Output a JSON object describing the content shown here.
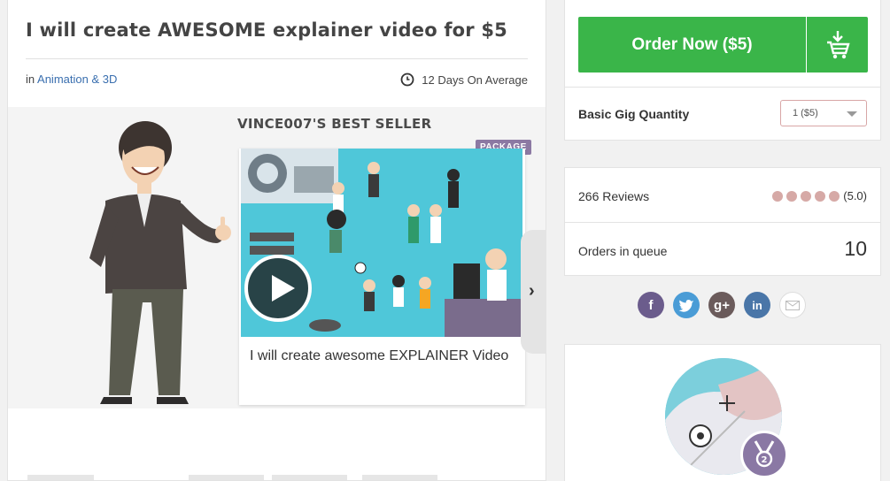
{
  "gig": {
    "title": "I will create AWESOME explainer video for $5",
    "category_prefix": "in",
    "category": "Animation & 3D",
    "delivery": "12 Days On Average"
  },
  "showcase": {
    "seller_title": "VINCE007'S BEST SELLER",
    "package_badge": "PACKAGE",
    "video_caption": "I will create awesome EXPLAINER Video"
  },
  "order": {
    "button_label": "Order Now ($5)",
    "quantity_label": "Basic Gig Quantity",
    "quantity_value": "1 ($5)"
  },
  "stats": {
    "reviews_label": "266 Reviews",
    "rating_value": "(5.0)",
    "rating_stars": 5,
    "queue_label": "Orders in queue",
    "queue_count": "10"
  },
  "share": {
    "facebook": "f",
    "google": "g+",
    "linkedin": "in"
  },
  "colors": {
    "order_green": "#3ab549",
    "badge_purple": "#8c79a3",
    "link_blue": "#3a6faf"
  },
  "icons": [
    "clock-icon",
    "cart-icon",
    "play-icon",
    "chevron-right-icon",
    "facebook-icon",
    "twitter-icon",
    "google-plus-icon",
    "linkedin-icon",
    "email-icon",
    "level-badge-icon"
  ]
}
